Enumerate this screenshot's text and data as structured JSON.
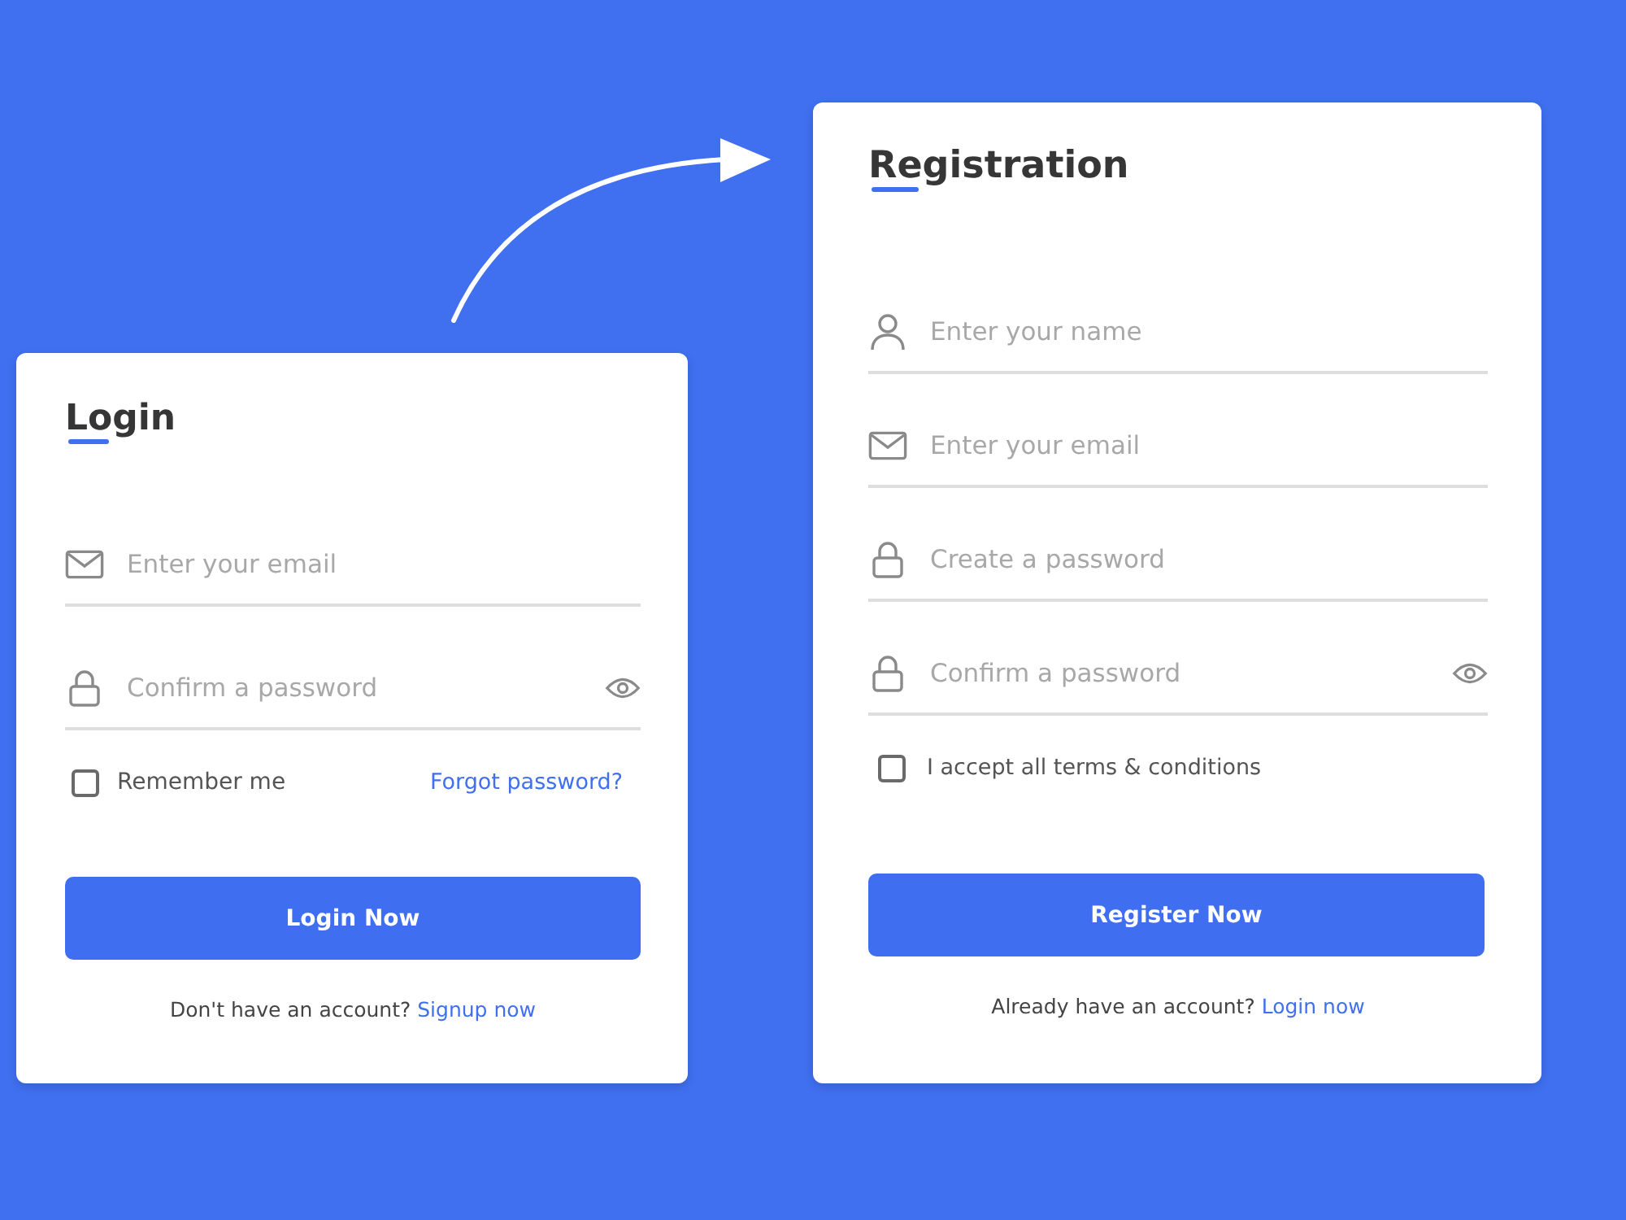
{
  "login": {
    "title": "Login",
    "fields": [
      {
        "kind": "email",
        "placeholder": "Enter your email",
        "toggle": false
      },
      {
        "kind": "password",
        "placeholder": "Confirm a password",
        "toggle": true
      }
    ],
    "remember": {
      "label": "Remember me",
      "checked": false
    },
    "forgot_link": "Forgot password?",
    "button": "Login Now",
    "footer": {
      "text": "Don't have an account?",
      "link": "Signup now"
    }
  },
  "registration": {
    "title": "Registration",
    "fields": [
      {
        "kind": "name",
        "placeholder": "Enter your name",
        "toggle": false
      },
      {
        "kind": "email",
        "placeholder": "Enter your email",
        "toggle": false
      },
      {
        "kind": "password",
        "placeholder": "Create a password",
        "toggle": false
      },
      {
        "kind": "password",
        "placeholder": "Confirm a password",
        "toggle": true
      }
    ],
    "terms": {
      "label": "I accept all terms & conditions",
      "checked": false
    },
    "button": "Register Now",
    "footer": {
      "text": "Already have an account?",
      "link": "Login now"
    }
  }
}
